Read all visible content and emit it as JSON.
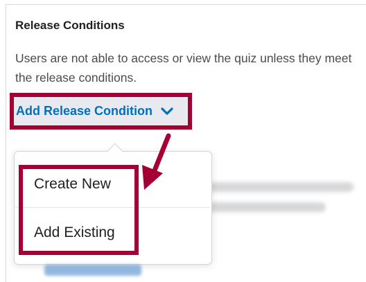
{
  "section": {
    "title": "Release Conditions",
    "description": "Users are not able to access or view the quiz unless they meet the release conditions."
  },
  "add_release_condition": {
    "label": "Add Release Condition",
    "icon": "chevron-down-icon"
  },
  "dropdown": {
    "items": [
      {
        "label": "Create New"
      },
      {
        "label": "Add Existing"
      }
    ]
  },
  "colors": {
    "annotation": "#a50034",
    "link": "#006fbf",
    "button_bg": "#e8eaf0",
    "text": "#202122",
    "muted_text": "#494c4e"
  }
}
